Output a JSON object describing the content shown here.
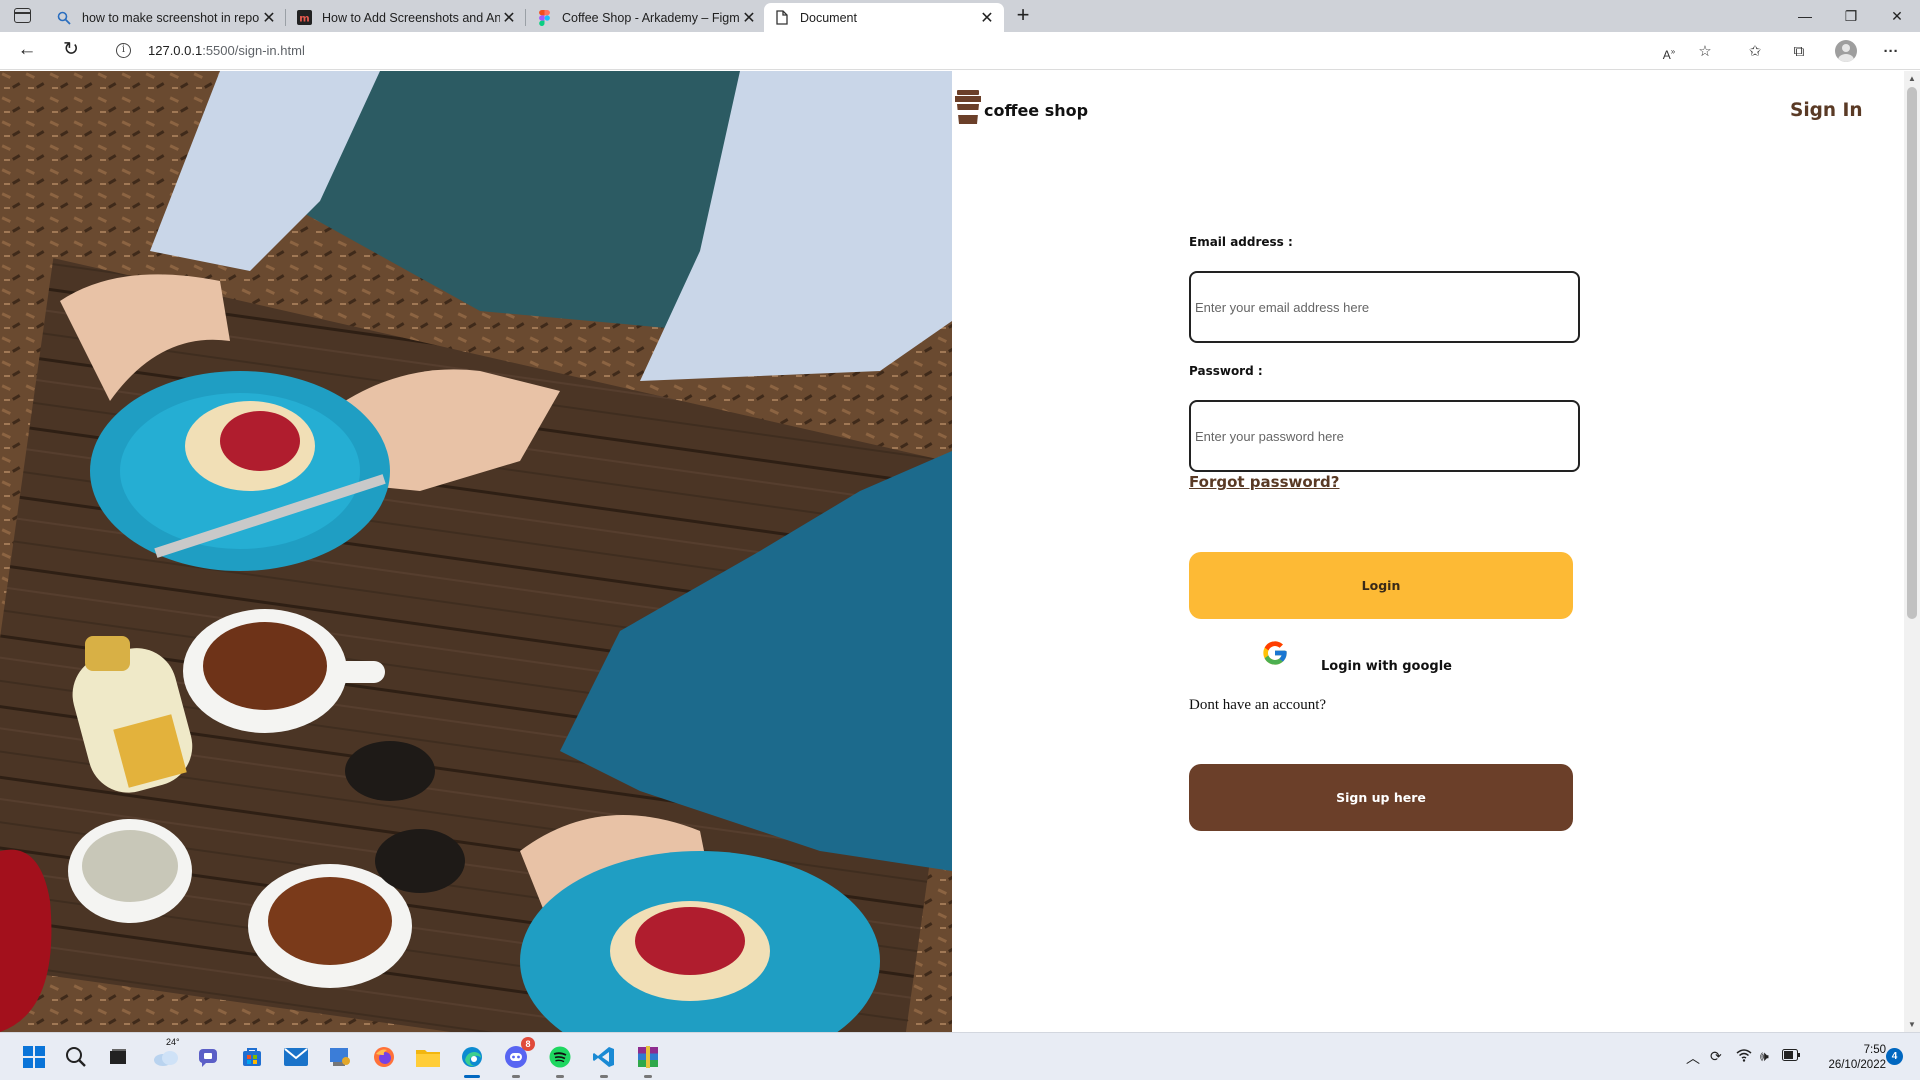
{
  "browser": {
    "tabs": [
      {
        "label": "how to make screenshot in repo",
        "icon": "search-icon"
      },
      {
        "label": "How to Add Screenshots and An",
        "icon": "site-m-icon"
      },
      {
        "label": "Coffee Shop - Arkademy – Figma",
        "icon": "figma-icon"
      },
      {
        "label": "Document",
        "icon": "document-icon"
      }
    ],
    "active_tab_index": 3,
    "url_host": "127.0.0.1",
    "url_rest": ":5500/sign-in.html"
  },
  "page": {
    "brand": "coffee shop",
    "nav_sign_in": "Sign In",
    "email_label": "Email address :",
    "email_placeholder": "Enter your email address here",
    "password_label": "Password :",
    "password_placeholder": "Enter your password here",
    "forgot_password": "Forgot password?",
    "login_button": "Login",
    "google_login": "Login with google",
    "no_account": "Dont have an account?",
    "signup_button": "Sign up here",
    "colors": {
      "brown": "#6b3f29",
      "yellow": "#fdba35"
    }
  },
  "taskbar": {
    "weather_temp": "24°",
    "chat_badge": "8",
    "time": "7:50",
    "date": "26/10/2022",
    "notifications": "4"
  }
}
